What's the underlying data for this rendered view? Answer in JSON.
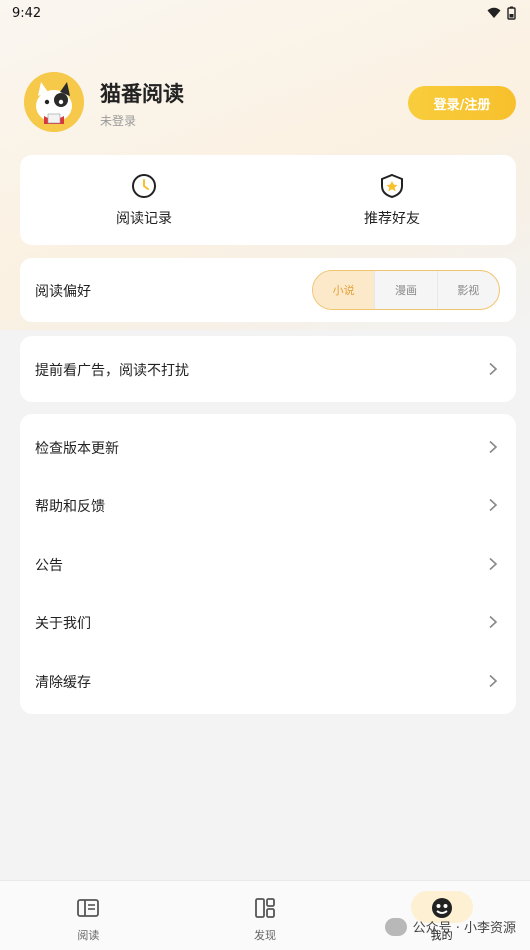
{
  "status_bar": {
    "time": "9:42"
  },
  "profile": {
    "app_name": "猫番阅读",
    "login_status": "未登录",
    "login_button": "登录/注册"
  },
  "quick_actions": [
    {
      "label": "阅读记录",
      "icon": "clock-icon"
    },
    {
      "label": "推荐好友",
      "icon": "shield-star-icon"
    }
  ],
  "preference": {
    "label": "阅读偏好",
    "options": [
      "小说",
      "漫画",
      "影视"
    ],
    "selected": "小说"
  },
  "ad_row": {
    "label": "提前看广告，阅读不打扰"
  },
  "menu": [
    {
      "label": "检查版本更新"
    },
    {
      "label": "帮助和反馈"
    },
    {
      "label": "公告"
    },
    {
      "label": "关于我们"
    },
    {
      "label": "清除缓存"
    }
  ],
  "bottom_nav": [
    {
      "label": "阅读",
      "icon": "book-icon"
    },
    {
      "label": "发现",
      "icon": "discover-icon"
    },
    {
      "label": "我的",
      "icon": "profile-icon",
      "active": true
    }
  ],
  "watermark": {
    "text": "公众号 · 小李资源"
  },
  "colors": {
    "accent": "#f7c02c",
    "accent_text": "#e6a23c",
    "active_pill": "#fdf0d3"
  }
}
